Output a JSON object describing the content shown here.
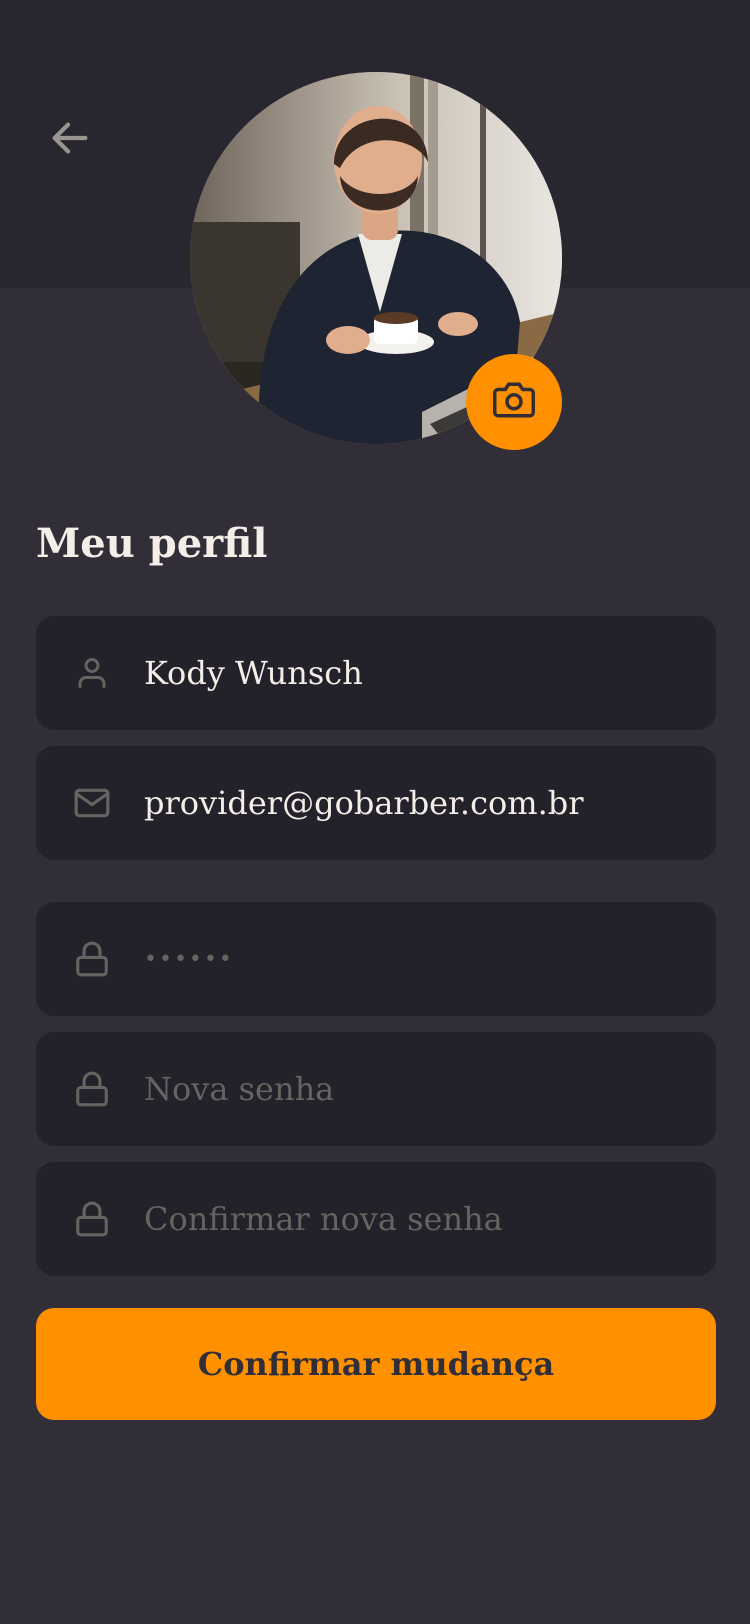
{
  "header": {
    "back_icon": "arrow-left-icon"
  },
  "avatar": {
    "camera_icon": "camera-icon"
  },
  "profile": {
    "title": "Meu perfil"
  },
  "form": {
    "name_value": "Kody Wunsch",
    "email_value": "provider@gobarber.com.br",
    "old_password_value": "••••••",
    "new_password_placeholder": "Nova senha",
    "confirm_password_placeholder": "Confirmar nova senha",
    "submit_label": "Confirmar mudança"
  },
  "colors": {
    "background": "#312e38",
    "header_background": "#28262e",
    "input_background": "#232129",
    "accent": "#ff9000",
    "text": "#f4ede8",
    "muted": "#666360"
  }
}
